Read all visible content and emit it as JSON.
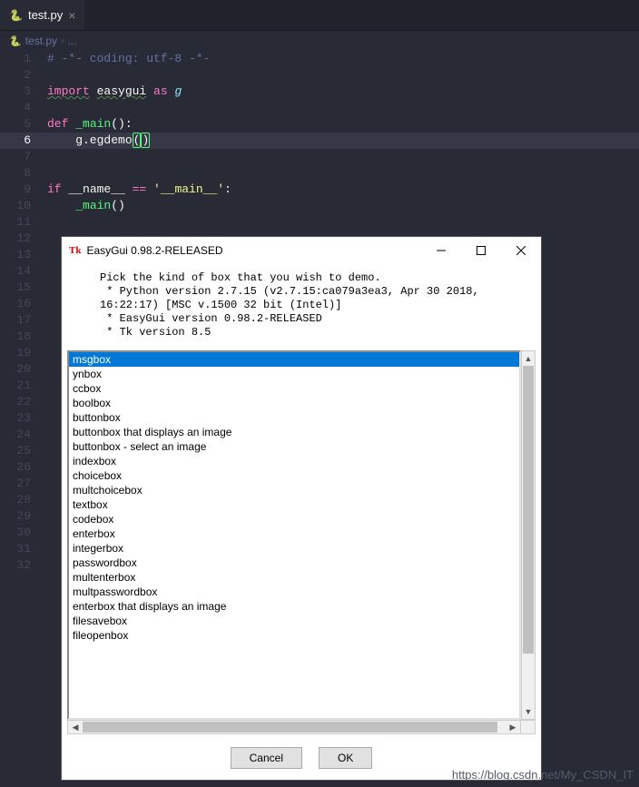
{
  "tab": {
    "filename": "test.py"
  },
  "breadcrumb": {
    "file": "test.py",
    "sep": "›",
    "more": "..."
  },
  "code": {
    "lines": [
      {
        "n": 1,
        "frags": [
          {
            "cls": "c-comment",
            "t": "# -*- coding: utf-8 -*-"
          }
        ]
      },
      {
        "n": 2,
        "frags": []
      },
      {
        "n": 3,
        "frags": [
          {
            "cls": "c-kw c-import",
            "t": "import"
          },
          {
            "cls": "",
            "t": " "
          },
          {
            "cls": "c-import",
            "t": "easygui"
          },
          {
            "cls": "",
            "t": " "
          },
          {
            "cls": "c-kw",
            "t": "as"
          },
          {
            "cls": "",
            "t": " "
          },
          {
            "cls": "c-lib",
            "t": "g"
          }
        ]
      },
      {
        "n": 4,
        "frags": []
      },
      {
        "n": 5,
        "frags": [
          {
            "cls": "c-kw",
            "t": "def"
          },
          {
            "cls": "",
            "t": " "
          },
          {
            "cls": "c-func",
            "t": "_main"
          },
          {
            "cls": "c-paren",
            "t": "():"
          }
        ]
      },
      {
        "n": 6,
        "frags": [
          {
            "cls": "",
            "t": "    g.egdemo"
          },
          {
            "cls": "c-hl-paren",
            "t": "("
          },
          {
            "cls": "c-hl-paren",
            "t": ")"
          }
        ],
        "hl": true
      },
      {
        "n": 7,
        "frags": []
      },
      {
        "n": 8,
        "frags": []
      },
      {
        "n": 9,
        "frags": [
          {
            "cls": "c-kw",
            "t": "if"
          },
          {
            "cls": "",
            "t": " __name__ "
          },
          {
            "cls": "c-kw",
            "t": "=="
          },
          {
            "cls": "",
            "t": " "
          },
          {
            "cls": "c-str",
            "t": "'__main__'"
          },
          {
            "cls": "",
            "t": ":"
          }
        ]
      },
      {
        "n": 10,
        "frags": [
          {
            "cls": "",
            "t": "    "
          },
          {
            "cls": "c-func",
            "t": "_main"
          },
          {
            "cls": "",
            "t": "()"
          }
        ]
      },
      {
        "n": 11,
        "frags": []
      },
      {
        "n": 12,
        "frags": []
      },
      {
        "n": 13,
        "frags": []
      },
      {
        "n": 14,
        "frags": []
      },
      {
        "n": 15,
        "frags": []
      },
      {
        "n": 16,
        "frags": []
      },
      {
        "n": 17,
        "frags": []
      },
      {
        "n": 18,
        "frags": []
      },
      {
        "n": 19,
        "frags": []
      },
      {
        "n": 20,
        "frags": []
      },
      {
        "n": 21,
        "frags": []
      },
      {
        "n": 22,
        "frags": []
      },
      {
        "n": 23,
        "frags": []
      },
      {
        "n": 24,
        "frags": []
      },
      {
        "n": 25,
        "frags": []
      },
      {
        "n": 26,
        "frags": []
      },
      {
        "n": 27,
        "frags": []
      },
      {
        "n": 28,
        "frags": []
      },
      {
        "n": 29,
        "frags": []
      },
      {
        "n": 30,
        "frags": []
      },
      {
        "n": 31,
        "frags": []
      },
      {
        "n": 32,
        "frags": []
      }
    ]
  },
  "dialog": {
    "title": "EasyGui 0.98.2-RELEASED",
    "message": "Pick the kind of box that you wish to demo.\n * Python version 2.7.15 (v2.7.15:ca079a3ea3, Apr 30 2018, 16:22:17) [MSC v.1500 32 bit (Intel)]\n * EasyGui version 0.98.2-RELEASED\n * Tk version 8.5",
    "items": [
      "msgbox",
      "ynbox",
      "ccbox",
      "boolbox",
      "buttonbox",
      "buttonbox that displays an image",
      "buttonbox - select an image",
      "indexbox",
      "choicebox",
      "multchoicebox",
      "textbox",
      "codebox",
      "enterbox",
      "integerbox",
      "passwordbox",
      "multenterbox",
      "multpasswordbox",
      "enterbox that displays an image",
      "filesavebox",
      "fileopenbox"
    ],
    "selected_index": 0,
    "buttons": {
      "cancel": "Cancel",
      "ok": "OK"
    }
  },
  "watermark": "https://blog.csdn.net/My_CSDN_IT"
}
